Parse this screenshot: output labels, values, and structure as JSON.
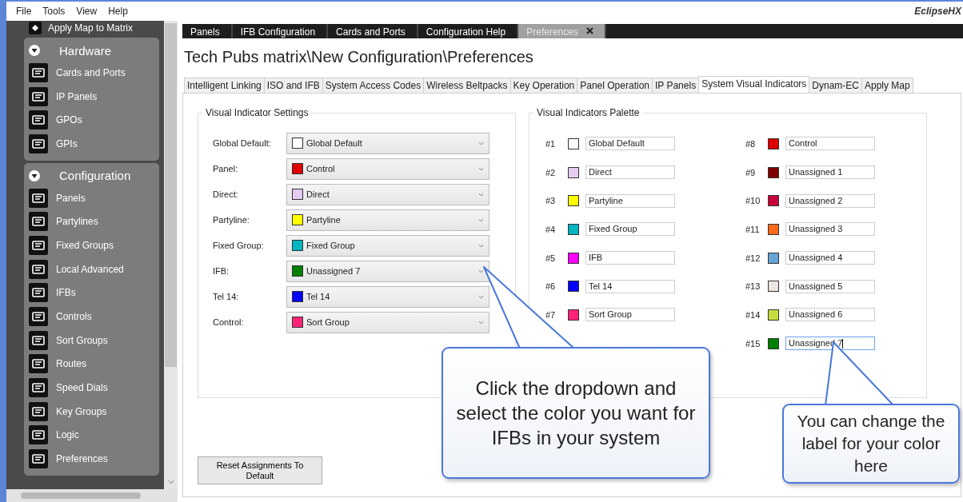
{
  "menu": [
    "File",
    "Tools",
    "View",
    "Help"
  ],
  "brand": "EclipseHX",
  "sidebar": {
    "top_item": "Apply Map to Matrix",
    "sections": [
      {
        "title": "Hardware",
        "expanded": true,
        "items": [
          "Cards and Ports",
          "IP Panels",
          "GPOs",
          "GPIs"
        ]
      },
      {
        "title": "Configuration",
        "expanded": true,
        "items": [
          "Panels",
          "Partylines",
          "Fixed Groups",
          "Local Advanced",
          "IFBs",
          "Controls",
          "Sort Groups",
          "Routes",
          "Speed Dials",
          "Key Groups",
          "Logic",
          "Preferences"
        ]
      }
    ]
  },
  "doc_tabs": [
    {
      "label": "Panels",
      "selected": false,
      "closable": false
    },
    {
      "label": "IFB Configuration",
      "selected": false,
      "closable": false
    },
    {
      "label": "Cards and Ports",
      "selected": false,
      "closable": false
    },
    {
      "label": "Configuration Help",
      "selected": false,
      "closable": false
    },
    {
      "label": "Preferences",
      "selected": true,
      "closable": true
    }
  ],
  "title": "Tech Pubs matrix\\New Configuration\\Preferences",
  "subtabs": [
    {
      "label": "Intelligent Linking",
      "selected": false
    },
    {
      "label": "ISO and IFB",
      "selected": false
    },
    {
      "label": "System Access Codes",
      "selected": false
    },
    {
      "label": "Wireless Beltpacks",
      "selected": false
    },
    {
      "label": "Key Operation",
      "selected": false
    },
    {
      "label": "Panel Operation",
      "selected": false
    },
    {
      "label": "IP Panels",
      "selected": false
    },
    {
      "label": "System Visual Indicators",
      "selected": true
    },
    {
      "label": "Dynam-EC",
      "selected": false
    },
    {
      "label": "Apply Map",
      "selected": false
    }
  ],
  "settings": {
    "title": "Visual Indicator Settings",
    "rows": [
      {
        "label": "Global Default:",
        "value": "Global Default",
        "color": "#ffffff"
      },
      {
        "label": "Panel:",
        "value": "Control",
        "color": "#e00000"
      },
      {
        "label": "Direct:",
        "value": "Direct",
        "color": "#e6ccf2"
      },
      {
        "label": "Partyline:",
        "value": "Partyline",
        "color": "#ffff00"
      },
      {
        "label": "Fixed Group:",
        "value": "Fixed Group",
        "color": "#00b4c0"
      },
      {
        "label": "IFB:",
        "value": "Unassigned 7",
        "color": "#008000"
      },
      {
        "label": "Tel 14:",
        "value": "Tel 14",
        "color": "#0000ff"
      },
      {
        "label": "Control:",
        "value": "Sort Group",
        "color": "#ff2277"
      }
    ]
  },
  "palette": {
    "title": "Visual Indicators Palette",
    "columns": [
      {
        "entries": [
          {
            "number": "#1",
            "color": "#ffffff",
            "label": "Global Default",
            "focused": false
          },
          {
            "number": "#2",
            "color": "#e6ccf2",
            "label": "Direct",
            "focused": false
          },
          {
            "number": "#3",
            "color": "#ffff00",
            "label": "Partyline",
            "focused": false
          },
          {
            "number": "#4",
            "color": "#00b4c0",
            "label": "Fixed Group",
            "focused": false
          },
          {
            "number": "#5",
            "color": "#ff00ff",
            "label": "IFB",
            "focused": false
          },
          {
            "number": "#6",
            "color": "#0000ff",
            "label": "Tel 14",
            "focused": false
          },
          {
            "number": "#7",
            "color": "#ff2277",
            "label": "Sort Group",
            "focused": false
          }
        ]
      },
      {
        "entries": [
          {
            "number": "#8",
            "color": "#e00000",
            "label": "Control",
            "focused": false
          },
          {
            "number": "#9",
            "color": "#800000",
            "label": "Unassigned 1",
            "focused": false
          },
          {
            "number": "#10",
            "color": "#c8003a",
            "label": "Unassigned 2",
            "focused": false
          },
          {
            "number": "#11",
            "color": "#ff6a1a",
            "label": "Unassigned 3",
            "focused": false
          },
          {
            "number": "#12",
            "color": "#66a4d4",
            "label": "Unassigned 4",
            "focused": false
          },
          {
            "number": "#13",
            "color": "#ece4e0",
            "label": "Unassigned 5",
            "focused": false
          },
          {
            "number": "#14",
            "color": "#c8dc40",
            "label": "Unassigned 6",
            "focused": false
          },
          {
            "number": "#15",
            "color": "#008000",
            "label": "Unassigned 7",
            "focused": true
          }
        ]
      }
    ]
  },
  "reset_button": "Reset Assignments To Default",
  "callouts": [
    {
      "text": "Click the dropdown and select the color you want for IFBs in your system"
    },
    {
      "text": "You can change the label for your color here"
    }
  ]
}
